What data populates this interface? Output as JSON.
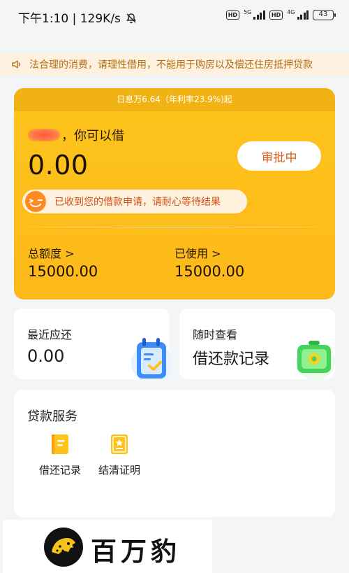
{
  "status_bar": {
    "time": "下午1:10",
    "speed": "129K/s",
    "network_badge_1": "HD",
    "network_1": "5G",
    "network_badge_2": "HD",
    "network_2": "4G",
    "battery": "43"
  },
  "notice_marquee": {
    "text": "法合理的消费，请理性借用，不能用于购房以及偿还住房抵押贷款"
  },
  "loan_card": {
    "rate_text": "日息万6.64（年利率23.9%)起",
    "greeting_suffix": "，你可以借",
    "available_amount": "0.00",
    "status_button": "审批中",
    "notice": "已收到您的借款申请，请耐心等待结果",
    "total_label": "总额度 >",
    "total_value": "15000.00",
    "used_label": "已使用 >",
    "used_value": "15000.00"
  },
  "repay_card": {
    "title": "最近应还",
    "value": "0.00"
  },
  "records_card": {
    "title": "随时查看",
    "value": "借还款记录"
  },
  "services": {
    "title": "贷款服务",
    "items": [
      {
        "label": "借还记录",
        "icon": "book-icon"
      },
      {
        "label": "结清证明",
        "icon": "certificate-icon"
      }
    ]
  },
  "brand": {
    "name": "百万豹"
  },
  "colors": {
    "accent": "#fdbf1c",
    "status_text": "#e05a16",
    "notice_text": "#b26f12"
  }
}
